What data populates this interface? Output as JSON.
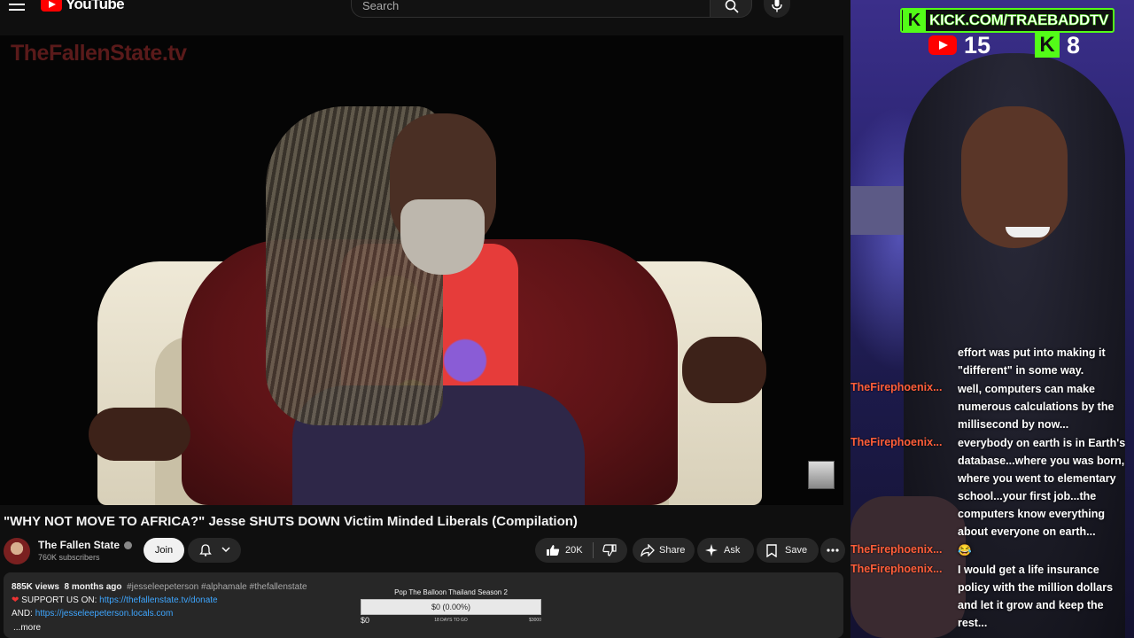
{
  "youtube": {
    "logo_text": "YouTube",
    "search_placeholder": "Search",
    "video": {
      "watermark": "TheFallenState.tv",
      "title": "\"WHY NOT MOVE TO AFRICA?\" Jesse SHUTS DOWN Victim Minded Liberals (Compilation)"
    },
    "channel": {
      "name": "The Fallen State",
      "subscribers": "760K subscribers",
      "join_label": "Join"
    },
    "actions": {
      "likes": "20K",
      "share_label": "Share",
      "ask_label": "Ask",
      "save_label": "Save"
    },
    "description": {
      "views": "885K views",
      "age": "8 months ago",
      "tags": "#jesseleepeterson #alphamale #thefallenstate",
      "line1_label": "SUPPORT US ON:",
      "line1_link": "https://thefallenstate.tv/donate",
      "line2_label": "AND:",
      "line2_link": "https://jesseleepeterson.locals.com",
      "more_label": "...more"
    },
    "goal_widget": {
      "title": "Pop The Balloon Thailand Season 2",
      "progress_text": "$0 (0.00%)",
      "progress_fraction": 0,
      "min_label": "$0",
      "days_label": "18 DAYS TO GO",
      "max_label": "$3000"
    }
  },
  "stream_overlay": {
    "banner_text": "KICK.COM/TRAEBADDTV",
    "youtube_viewers": "15",
    "kick_viewers": "8",
    "brand_green": "#53fc18",
    "chat": [
      {
        "user": "",
        "text": "effort was put into making it \"different\" in some way."
      },
      {
        "user": "TheFirephoenix...",
        "text": "well, computers can make numerous calculations by the millisecond by now..."
      },
      {
        "user": "TheFirephoenix...",
        "text": "everybody on earth is in Earth's database...where you was born, where you went to elementary school...your first job...the computers know everything about everyone on earth..."
      },
      {
        "user": "TheFirephoenix...",
        "text": "😂"
      },
      {
        "user": "TheFirephoenix...",
        "text": "I would get a life insurance policy with the million dollars and let it grow and keep the rest..."
      }
    ]
  }
}
